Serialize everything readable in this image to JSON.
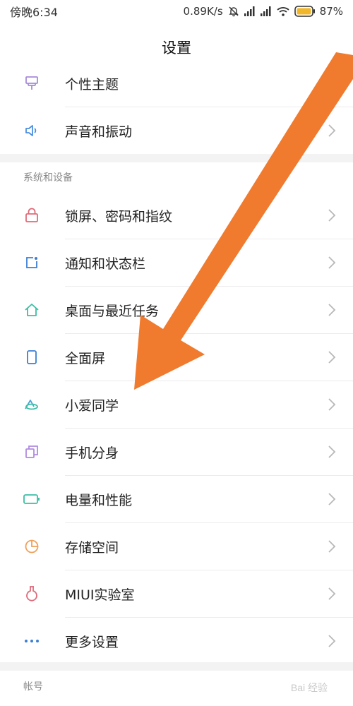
{
  "status": {
    "time": "傍晚6:34",
    "speed": "0.89K/s",
    "battery": "87%"
  },
  "header": {
    "title": "设置"
  },
  "top_items": [
    {
      "label": "个性主题",
      "icon": "theme-icon"
    },
    {
      "label": "声音和振动",
      "icon": "sound-icon"
    }
  ],
  "section_system": {
    "title": "系统和设备"
  },
  "system_items": [
    {
      "label": "锁屏、密码和指纹",
      "icon": "lock-icon"
    },
    {
      "label": "通知和状态栏",
      "icon": "notification-icon"
    },
    {
      "label": "桌面与最近任务",
      "icon": "home-icon"
    },
    {
      "label": "全面屏",
      "icon": "fullscreen-phone-icon"
    },
    {
      "label": "小爱同学",
      "icon": "xiaoai-icon"
    },
    {
      "label": "手机分身",
      "icon": "second-space-icon"
    },
    {
      "label": "电量和性能",
      "icon": "battery-icon"
    },
    {
      "label": "存储空间",
      "icon": "storage-icon"
    },
    {
      "label": "MIUI实验室",
      "icon": "lab-icon"
    },
    {
      "label": "更多设置",
      "icon": "more-icon"
    }
  ],
  "section_account": {
    "title": "帐号"
  },
  "watermark": "Bai 经验",
  "colors": {
    "arrow": "#f07a2e",
    "chevron": "#b8b8b8",
    "section_gap": "#f3f3f3"
  }
}
